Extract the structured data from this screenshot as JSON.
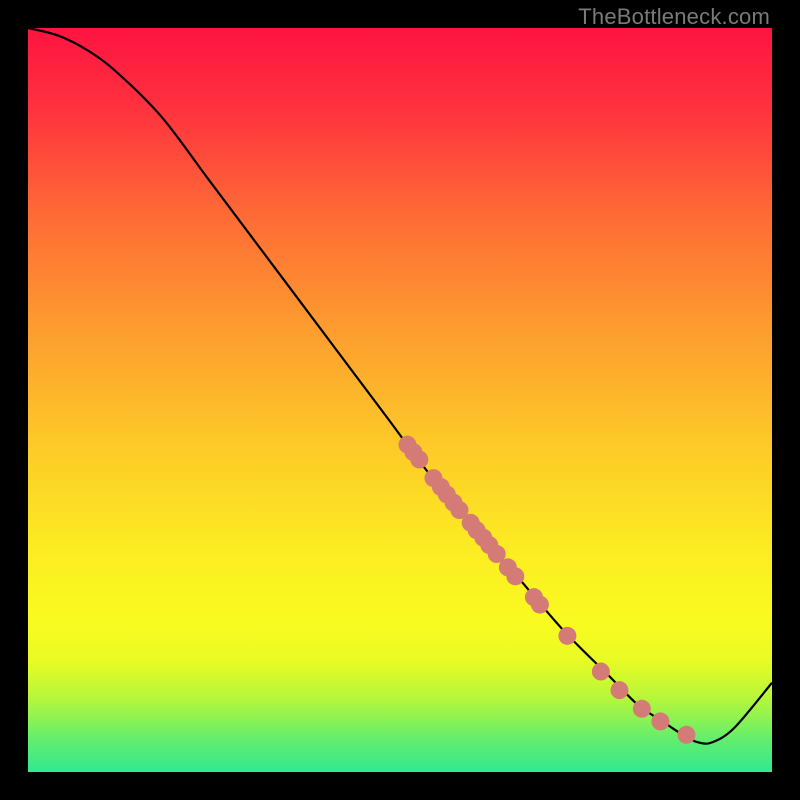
{
  "watermark": "TheBottleneck.com",
  "colors": {
    "frame": "#000000",
    "curve": "#000000",
    "dot_fill": "#d57b77",
    "dot_stroke": "#c86a66"
  },
  "gradient_stops": [
    {
      "offset": 0.0,
      "color": "#fe1441"
    },
    {
      "offset": 0.1,
      "color": "#fe2f3e"
    },
    {
      "offset": 0.25,
      "color": "#fe6a36"
    },
    {
      "offset": 0.4,
      "color": "#fd9b2f"
    },
    {
      "offset": 0.55,
      "color": "#fdc728"
    },
    {
      "offset": 0.7,
      "color": "#fcec22"
    },
    {
      "offset": 0.8,
      "color": "#f9fb20"
    },
    {
      "offset": 0.85,
      "color": "#e8fb24"
    },
    {
      "offset": 0.9,
      "color": "#b7f73a"
    },
    {
      "offset": 0.93,
      "color": "#8af254"
    },
    {
      "offset": 0.96,
      "color": "#5ded71"
    },
    {
      "offset": 1.0,
      "color": "#32e890"
    }
  ],
  "chart_data": {
    "type": "line",
    "title": "",
    "xlabel": "",
    "ylabel": "",
    "xlim": [
      0,
      100
    ],
    "ylim": [
      0,
      100
    ],
    "series": [
      {
        "name": "curve",
        "x": [
          0,
          4,
          8,
          12,
          18,
          24,
          30,
          36,
          42,
          48,
          54,
          60,
          66,
          72,
          78,
          82,
          85,
          88,
          90,
          92,
          95,
          100
        ],
        "y": [
          100,
          99,
          97,
          94,
          88,
          80,
          72,
          64,
          56,
          48,
          40,
          33,
          26,
          19,
          13,
          9,
          7,
          5,
          4,
          4,
          6,
          12
        ]
      }
    ],
    "points": [
      {
        "x": 51.0,
        "y": 44.0
      },
      {
        "x": 51.8,
        "y": 43.0
      },
      {
        "x": 52.6,
        "y": 42.0
      },
      {
        "x": 54.5,
        "y": 39.5
      },
      {
        "x": 55.5,
        "y": 38.3
      },
      {
        "x": 56.3,
        "y": 37.3
      },
      {
        "x": 57.2,
        "y": 36.2
      },
      {
        "x": 58.0,
        "y": 35.2
      },
      {
        "x": 59.5,
        "y": 33.5
      },
      {
        "x": 60.3,
        "y": 32.5
      },
      {
        "x": 61.2,
        "y": 31.5
      },
      {
        "x": 62.0,
        "y": 30.5
      },
      {
        "x": 63.0,
        "y": 29.3
      },
      {
        "x": 64.5,
        "y": 27.5
      },
      {
        "x": 65.5,
        "y": 26.3
      },
      {
        "x": 68.0,
        "y": 23.5
      },
      {
        "x": 68.8,
        "y": 22.5
      },
      {
        "x": 72.5,
        "y": 18.3
      },
      {
        "x": 77.0,
        "y": 13.5
      },
      {
        "x": 79.5,
        "y": 11.0
      },
      {
        "x": 82.5,
        "y": 8.5
      },
      {
        "x": 85.0,
        "y": 6.8
      },
      {
        "x": 88.5,
        "y": 5.0
      }
    ],
    "point_radius": 9
  }
}
